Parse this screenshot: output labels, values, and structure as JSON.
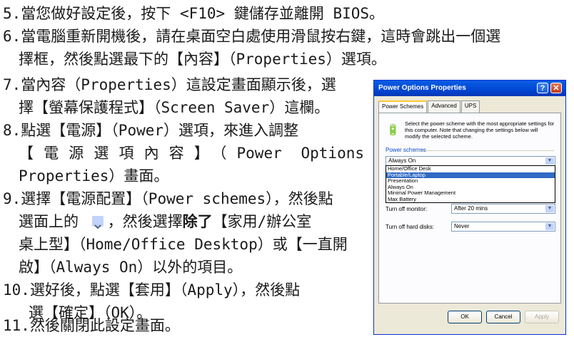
{
  "steps": [
    {
      "num": "5.",
      "lines": [
        "當您做好設定後，按下 <F10> 鍵儲存並離開 BIOS。"
      ]
    },
    {
      "num": "6.",
      "lines": [
        "當電腦重新開機後，請在桌面空白處使用滑鼠按右鍵，這時會跳出一個選",
        "擇框，然後點選最下的【內容】（Properties）選項。"
      ]
    },
    {
      "num": "7.",
      "lines": [
        "當內容（Properties）這設定畫面顯示後，選",
        "擇【螢幕保護程式】（Screen Saver）這欄。"
      ]
    },
    {
      "num": "8.",
      "lines": [
        "點選【電源】（Power）選項，來進入調整",
        "【電源選項內容】（Power Options",
        "Properties）畫面。"
      ]
    },
    {
      "num": "9.",
      "lines": [
        "選擇【電源配置】（Power schemes），然後點",
        "選面上的",
        "，然後選擇",
        "除了",
        "【家用/辦公室",
        "桌上型】（Home/Office Desktop）或【一直開",
        "啟】（Always On）以外的項目。"
      ]
    },
    {
      "num": "10.",
      "lines": [
        "選好後，點選【套用】（Apply），然後點",
        "選【確定】（OK）。"
      ]
    },
    {
      "num": "11.",
      "lines": [
        "然後關閉此設定畫面。"
      ]
    }
  ],
  "dialog": {
    "title": "Power Options Properties",
    "help": "?",
    "close": "✕",
    "tabs": [
      "Power Schemes",
      "Advanced",
      "UPS"
    ],
    "description": "Select the power scheme with the most appropriate settings for this computer. Note that changing the settings below will modify the selected scheme.",
    "group_label": "Power schemes",
    "selected_scheme": "Always On",
    "scheme_options": [
      "Home/Office Desk",
      "Portable/Laptop",
      "Presentation",
      "Always On",
      "Minimal Power Management",
      "Max Battery"
    ],
    "highlighted_option": "Portable/Laptop",
    "monitor_label": "Turn off monitor:",
    "monitor_value": "After 20 mins",
    "disks_label": "Turn off hard disks:",
    "disks_value": "Never",
    "ok": "OK",
    "cancel": "Cancel",
    "apply": "Apply"
  }
}
